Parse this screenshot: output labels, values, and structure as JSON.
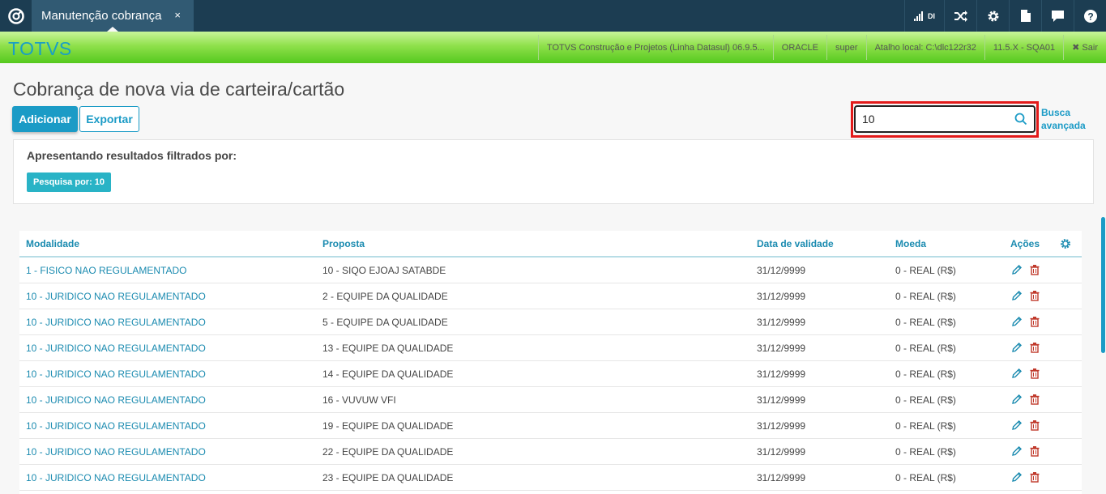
{
  "topbar": {
    "tab_label": "Manutenção cobrança",
    "tab_close": "×",
    "signal_label": "DI",
    "icons": [
      "logo-icon",
      "signal-icon",
      "shuffle-icon",
      "gear-icon",
      "document-icon",
      "chat-icon",
      "help-icon"
    ],
    "color": "#1c3d52"
  },
  "header": {
    "brand": "TOTVS",
    "info": [
      "TOTVS Construção e Projetos (Linha Datasul) 06.9.5...",
      "ORACLE",
      "super",
      "Atalho local: C:\\dlc122r32",
      "11.5.X - SQA01"
    ],
    "logout_label": "✖ Sair"
  },
  "page": {
    "title": "Cobrança de nova via de carteira/cartão",
    "add_label": "Adicionar",
    "export_label": "Exportar",
    "accent": "#1b9bc6"
  },
  "search": {
    "value": "10",
    "advanced_label_1": "Busca",
    "advanced_label_2": "avançada"
  },
  "filter": {
    "title": "Apresentando resultados filtrados por:",
    "tag": "Pesquisa por: 10"
  },
  "table": {
    "headers": {
      "modalidade": "Modalidade",
      "proposta": "Proposta",
      "validade": "Data de validade",
      "moeda": "Moeda",
      "acoes": "Ações"
    },
    "rows": [
      {
        "modalidade": "1 - FISICO NAO REGULAMENTADO",
        "proposta": "10 - SIQO EJOAJ SATABDE",
        "validade": "31/12/9999",
        "moeda": "0 - REAL (R$)"
      },
      {
        "modalidade": "10 - JURIDICO NAO REGULAMENTADO",
        "proposta": "2 - EQUIPE DA QUALIDADE",
        "validade": "31/12/9999",
        "moeda": "0 - REAL (R$)"
      },
      {
        "modalidade": "10 - JURIDICO NAO REGULAMENTADO",
        "proposta": "5 - EQUIPE DA QUALIDADE",
        "validade": "31/12/9999",
        "moeda": "0 - REAL (R$)"
      },
      {
        "modalidade": "10 - JURIDICO NAO REGULAMENTADO",
        "proposta": "13 - EQUIPE DA QUALIDADE",
        "validade": "31/12/9999",
        "moeda": "0 - REAL (R$)"
      },
      {
        "modalidade": "10 - JURIDICO NAO REGULAMENTADO",
        "proposta": "14 - EQUIPE DA QUALIDADE",
        "validade": "31/12/9999",
        "moeda": "0 - REAL (R$)"
      },
      {
        "modalidade": "10 - JURIDICO NAO REGULAMENTADO",
        "proposta": "16 - VUVUW VFI",
        "validade": "31/12/9999",
        "moeda": "0 - REAL (R$)"
      },
      {
        "modalidade": "10 - JURIDICO NAO REGULAMENTADO",
        "proposta": "19 - EQUIPE DA QUALIDADE",
        "validade": "31/12/9999",
        "moeda": "0 - REAL (R$)"
      },
      {
        "modalidade": "10 - JURIDICO NAO REGULAMENTADO",
        "proposta": "22 - EQUIPE DA QUALIDADE",
        "validade": "31/12/9999",
        "moeda": "0 - REAL (R$)"
      },
      {
        "modalidade": "10 - JURIDICO NAO REGULAMENTADO",
        "proposta": "23 - EQUIPE DA QUALIDADE",
        "validade": "31/12/9999",
        "moeda": "0 - REAL (R$)"
      }
    ],
    "edit_color": "#1b8bb0",
    "delete_color": "#c0392b"
  }
}
